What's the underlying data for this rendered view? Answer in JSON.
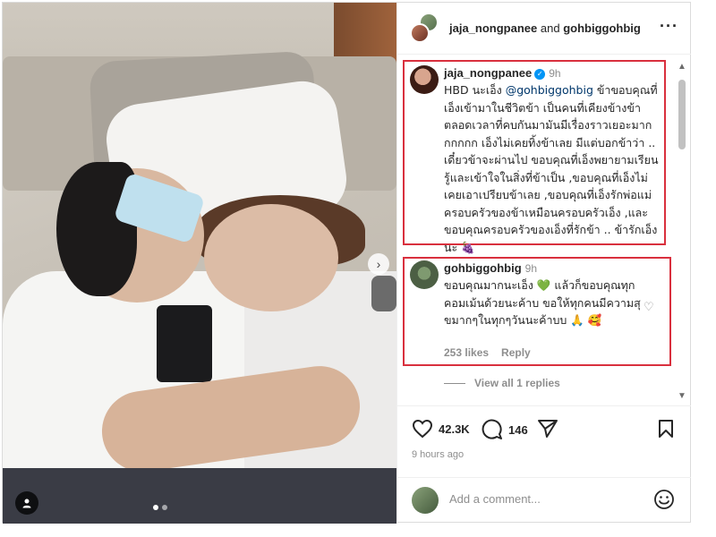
{
  "colors": {
    "accent": "#0095f6",
    "highlight_box": "#d9303e",
    "text_muted": "#8e8e8e"
  },
  "header": {
    "user1": "jaja_nongpanee",
    "conjunction": "and",
    "user2": "gohbiggohbig",
    "more_icon": "more-horizontal-icon"
  },
  "caption": {
    "username": "jaja_nongpanee",
    "verified": true,
    "time": "9h",
    "text_prefix": "HBD นะเอ็ง ",
    "mention": "@gohbiggohbig",
    "text_rest": " ข้าขอบคุณที่เอ็งเข้ามาในชีวิตข้า เป็นคนที่เคียงข้างข้าตลอดเวลาที่คบกันมามันมีเรื่องราวเยอะมากกกกกก เอ็งไม่เคยทิ้งข้าเลย มีแต่บอกข้าว่า .. เดี๋ยวข้าจะผ่านไป ขอบคุณที่เอ็งพยายามเรียนรู้และเข้าใจในสิ่งที่ข้าเป็น ,ขอบคุณที่เอ็งไม่เคยเอาเปรียบข้าเลย ,ขอบคุณที่เอ็งรักพ่อแม่ ครอบครัวของข้าเหมือนครอบครัวเอ็ง ,และขอบคุณครอบครัวของเอ็งที่รักข้า .. ข้ารักเอ็งนะ 🍇"
  },
  "reply": {
    "username": "gohbiggohbig",
    "time": "9h",
    "text": "ขอบคุณมากนะเอ็ง 💚 แล้วก็ขอบคุณทุกคอมเม้นด้วยนะค้าบ ขอให้ทุกคนมีความสุขมากๆในทุกๆวันนะค้าบบ 🙏 🥰",
    "likes": "253 likes",
    "reply_label": "Reply"
  },
  "view_replies": "View all 1 replies",
  "actions": {
    "likes_count": "42.3K",
    "comments_count": "146",
    "time_ago": "9 hours ago"
  },
  "add_comment": {
    "placeholder": "Add a comment..."
  }
}
